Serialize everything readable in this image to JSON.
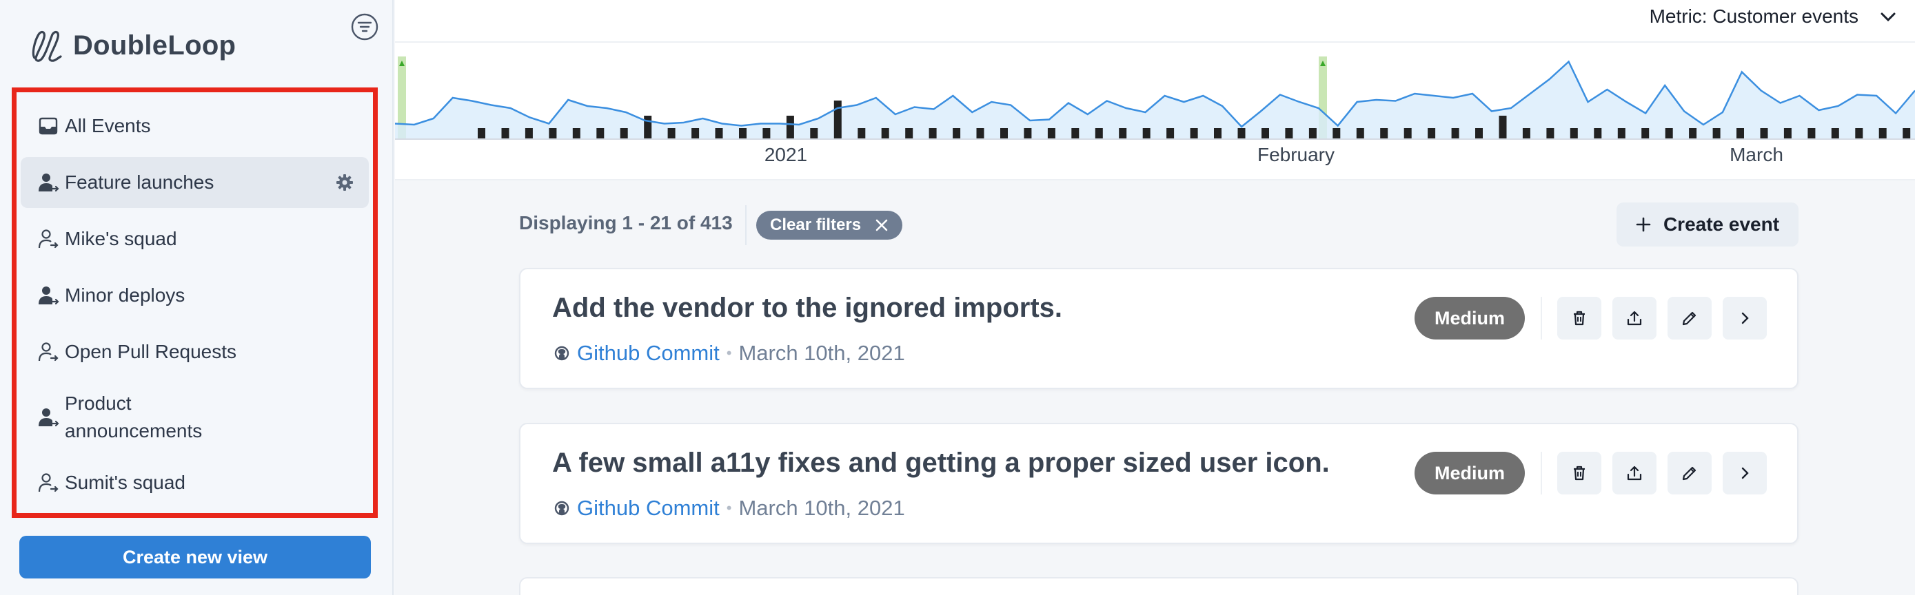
{
  "brand": {
    "name": "DoubleLoop"
  },
  "sidebar": {
    "views": [
      {
        "label": "All Events",
        "icon": "inbox-icon",
        "active": false
      },
      {
        "label": "Feature launches",
        "icon": "user-filled-icon",
        "active": true
      },
      {
        "label": "Mike's squad",
        "icon": "user-outline-icon",
        "active": false
      },
      {
        "label": "Minor deploys",
        "icon": "user-filled-icon",
        "active": false
      },
      {
        "label": "Open Pull Requests",
        "icon": "user-outline-icon",
        "active": false
      },
      {
        "label": "Product announcements",
        "icon": "user-filled-icon",
        "active": false
      },
      {
        "label": "Sumit's squad",
        "icon": "user-outline-icon",
        "active": false
      }
    ],
    "create_view_label": "Create new view"
  },
  "chart": {
    "metric_label": "Metric: Customer events",
    "month_labels": [
      "2021",
      "February",
      "March"
    ],
    "colors": {
      "line": "#3b8fe0",
      "area": "#d9ecfb",
      "bars": "#222222",
      "marker": "#c9e6b4",
      "marker_arrow": "#3aa82a"
    }
  },
  "chart_data": {
    "type": "line",
    "title": "",
    "xlabel": "",
    "ylabel": "",
    "x_tick_labels": [
      "2021",
      "February",
      "March"
    ],
    "series": [
      {
        "values": [
          15,
          14,
          20,
          40,
          37,
          33,
          30,
          21,
          15,
          38,
          32,
          30,
          26,
          18,
          15,
          16,
          20,
          15,
          13,
          15,
          15,
          14,
          20,
          30,
          33,
          40,
          24,
          31,
          29,
          42,
          26,
          36,
          33,
          18,
          19,
          35,
          24,
          37,
          30,
          26,
          42,
          36,
          42,
          32,
          12,
          27,
          43,
          36,
          30,
          13,
          36,
          38,
          37,
          44,
          42,
          40,
          44,
          27,
          30,
          44,
          58,
          75,
          36,
          48,
          36,
          25,
          52,
          27,
          14,
          26,
          65,
          47,
          35,
          42,
          28,
          32,
          43,
          42,
          25,
          47
        ]
      }
    ],
    "event_bars": {
      "values": [
        1,
        1,
        1,
        1,
        1,
        1,
        1,
        2,
        1,
        1,
        1,
        1,
        1,
        2,
        1,
        3,
        1,
        1,
        1,
        1,
        1,
        1,
        1,
        1,
        1,
        1,
        1,
        1,
        1,
        1,
        1,
        1,
        1,
        1,
        1,
        1,
        1,
        1,
        1,
        1,
        1,
        1,
        1,
        2,
        1,
        1,
        1,
        1,
        1,
        1,
        1,
        1,
        1,
        1,
        1,
        1,
        1,
        1,
        1,
        1,
        1,
        1,
        1,
        1
      ]
    }
  },
  "list": {
    "display_count": "Displaying 1 - 21 of 413",
    "clear_filters_label": "Clear filters",
    "create_event_label": "Create event",
    "events": [
      {
        "title": "Add the vendor to the ignored imports.",
        "source": "Github Commit",
        "date": "March 10th, 2021",
        "priority": "Medium"
      },
      {
        "title": "A few small a11y fixes and getting a proper sized user icon.",
        "source": "Github Commit",
        "date": "March 10th, 2021",
        "priority": "Medium"
      }
    ]
  }
}
